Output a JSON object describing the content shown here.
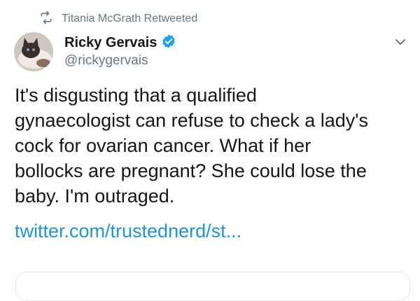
{
  "retweet": {
    "icon": "retweet-icon",
    "label": "Titania McGrath Retweeted"
  },
  "author": {
    "avatar": "avatar-cat",
    "display_name": "Ricky Gervais",
    "verified_icon": "verified-badge-icon",
    "handle": "@rickygervais"
  },
  "menu": {
    "icon": "chevron-down-icon"
  },
  "tweet": {
    "lines": [
      "It's disgusting that a qualified",
      "gynaecologist can refuse to check a lady's",
      "cock for ovarian cancer. What if her",
      "bollocks are pregnant? She could lose the",
      "baby. I'm outraged."
    ],
    "link": "twitter.com/trustednerd/st..."
  },
  "colors": {
    "text": "#14171a",
    "secondary": "#657786",
    "link": "#1b95e0",
    "verified": "#1da1f2",
    "border": "#e1e8ed"
  }
}
